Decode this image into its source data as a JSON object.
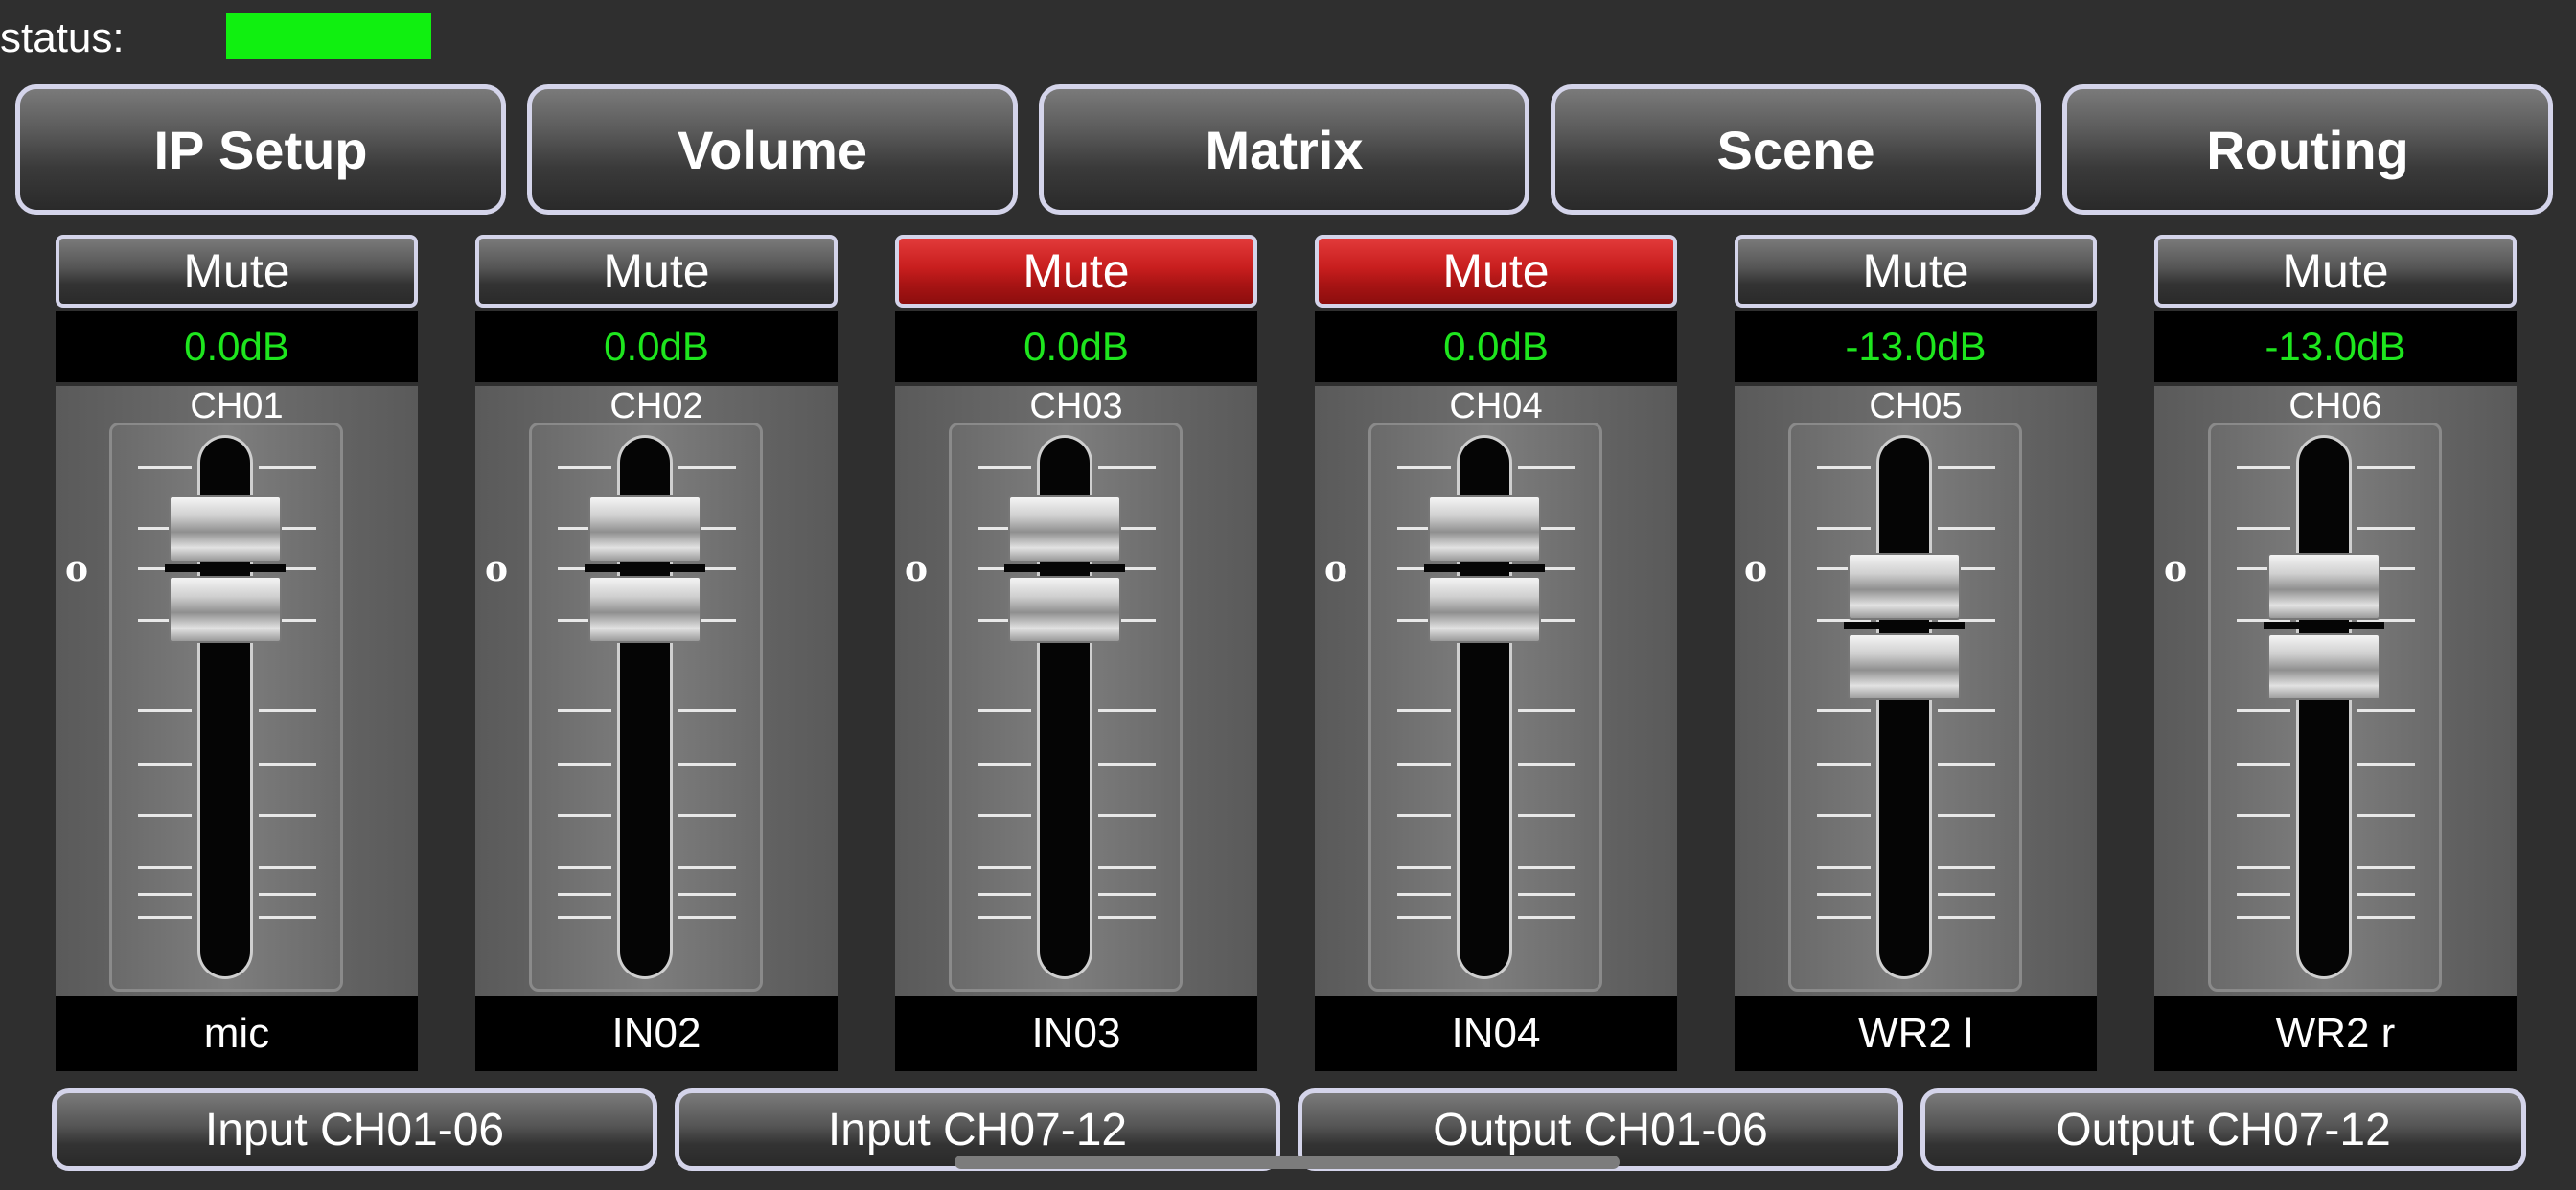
{
  "status": {
    "label": "status:",
    "indicator_color": "#10f010"
  },
  "nav": {
    "tabs": [
      {
        "label": "IP Setup",
        "active": false
      },
      {
        "label": "Volume",
        "active": true
      },
      {
        "label": "Matrix",
        "active": false
      },
      {
        "label": "Scene",
        "active": false
      },
      {
        "label": "Routing",
        "active": false
      }
    ]
  },
  "fader_scale": {
    "zero_label": "o"
  },
  "channels": [
    {
      "mute_label": "Mute",
      "muted": false,
      "level": "0.0dB",
      "level_db": 0.0,
      "channel": "CH01",
      "name": "mic"
    },
    {
      "mute_label": "Mute",
      "muted": false,
      "level": "0.0dB",
      "level_db": 0.0,
      "channel": "CH02",
      "name": "IN02"
    },
    {
      "mute_label": "Mute",
      "muted": true,
      "level": "0.0dB",
      "level_db": 0.0,
      "channel": "CH03",
      "name": "IN03"
    },
    {
      "mute_label": "Mute",
      "muted": true,
      "level": "0.0dB",
      "level_db": 0.0,
      "channel": "CH04",
      "name": "IN04"
    },
    {
      "mute_label": "Mute",
      "muted": false,
      "level": "-13.0dB",
      "level_db": -13.0,
      "channel": "CH05",
      "name": "WR2 l"
    },
    {
      "mute_label": "Mute",
      "muted": false,
      "level": "-13.0dB",
      "level_db": -13.0,
      "channel": "CH06",
      "name": "WR2 r"
    }
  ],
  "pages": {
    "tabs": [
      {
        "label": "Input CH01-06",
        "active": true
      },
      {
        "label": "Input CH07-12",
        "active": false
      },
      {
        "label": "Output CH01-06",
        "active": false
      },
      {
        "label": "Output CH07-12",
        "active": false
      }
    ]
  },
  "colors": {
    "active_green": "#22e022",
    "mute_red": "#c81e1e",
    "level_text": "#1ee61e"
  }
}
